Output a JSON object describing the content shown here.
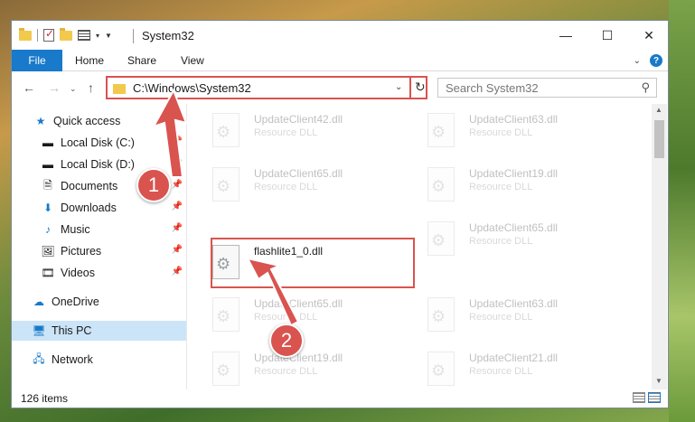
{
  "window": {
    "title": "System32"
  },
  "ribbon": {
    "file": "File",
    "home": "Home",
    "share": "Share",
    "view": "View"
  },
  "address": {
    "path": "C:\\Windows\\System32"
  },
  "search": {
    "placeholder": "Search System32"
  },
  "sidebar": {
    "items": [
      {
        "label": "Quick access"
      },
      {
        "label": "Local Disk (C:)"
      },
      {
        "label": "Local Disk (D:)"
      },
      {
        "label": "Documents"
      },
      {
        "label": "Downloads"
      },
      {
        "label": "Music"
      },
      {
        "label": "Pictures"
      },
      {
        "label": "Videos"
      },
      {
        "label": "OneDrive"
      },
      {
        "label": "This PC"
      },
      {
        "label": "Network"
      }
    ]
  },
  "files": [
    {
      "name": "UpdateClient42.dll",
      "type": "Resource DLL"
    },
    {
      "name": "UpdateClient63.dll",
      "type": "Resource DLL"
    },
    {
      "name": "UpdateClient65.dll",
      "type": "Resource DLL"
    },
    {
      "name": "UpdateClient19.dll",
      "type": "Resource DLL"
    },
    {
      "name": "flashlite1_0.dll",
      "type": ""
    },
    {
      "name": "UpdateClient65.dll",
      "type": "Resource DLL"
    },
    {
      "name": "UpdateClient65.dll",
      "type": "Resource DLL"
    },
    {
      "name": "UpdateClient63.dll",
      "type": "Resource DLL"
    },
    {
      "name": "UpdateClient19.dll",
      "type": "Resource DLL"
    },
    {
      "name": "UpdateClient21.dll",
      "type": "Resource DLL"
    }
  ],
  "status": {
    "count": "126 items"
  },
  "annotations": {
    "step1": "1",
    "step2": "2"
  },
  "colors": {
    "accent": "#1979ca",
    "highlight": "#d9534f",
    "selected": "#cce4f7"
  }
}
